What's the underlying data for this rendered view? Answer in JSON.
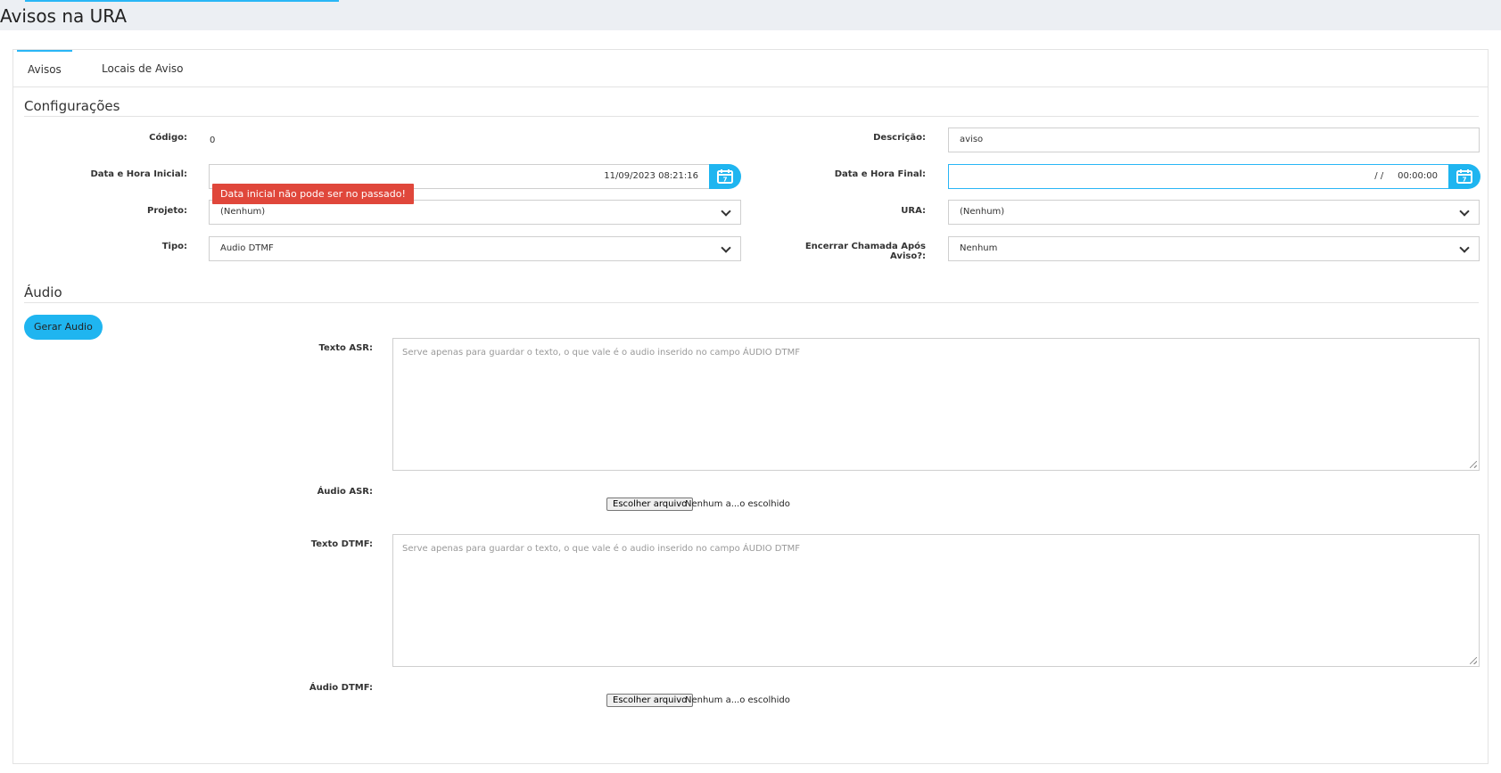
{
  "page": {
    "title": "Avisos na URA"
  },
  "tabs": [
    {
      "label": "Avisos"
    },
    {
      "label": "Locais de Aviso"
    }
  ],
  "configuracoes": {
    "title": "Configurações",
    "codigo": {
      "label": "Código:",
      "value": "0"
    },
    "descricao": {
      "label": "Descrição:",
      "value": "aviso"
    },
    "data_inicial": {
      "label": "Data e Hora Inicial:",
      "value": "11/09/2023 08:21:16"
    },
    "data_final": {
      "label": "Data e Hora Final:",
      "value": "/ /     00:00:00"
    },
    "error_message": "Data inicial não pode ser no passado!",
    "projeto": {
      "label": "Projeto:",
      "value": "(Nenhum)"
    },
    "ura": {
      "label": "URA:",
      "value": "(Nenhum)"
    },
    "tipo": {
      "label": "Tipo:",
      "value": "Audio DTMF"
    },
    "encerrar": {
      "label": "Encerrar Chamada Após Aviso?:",
      "value": "Nenhum"
    }
  },
  "audio": {
    "title": "Áudio",
    "gerar_button": "Gerar Audio",
    "texto_asr": {
      "label": "Texto ASR:",
      "placeholder": "Serve apenas para guardar o texto, o que vale é o audio inserido no campo ÁUDIO DTMF"
    },
    "audio_asr": {
      "label": "Áudio ASR:",
      "button": "Escolher arquivo",
      "status": "Nenhum a...o escolhido"
    },
    "texto_dtmf": {
      "label": "Texto DTMF:",
      "placeholder": "Serve apenas para guardar o texto, o que vale é o audio inserido no campo ÁUDIO DTMF"
    },
    "audio_dtmf": {
      "label": "Áudio DTMF:",
      "button": "Escolher arquivo",
      "status": "Nenhum a...o escolhido"
    }
  },
  "colors": {
    "accent": "#1fb5f0",
    "error": "#e0473b"
  },
  "icons": {
    "calendar": "calendar-icon",
    "dropdown": "chevron-down-icon"
  }
}
